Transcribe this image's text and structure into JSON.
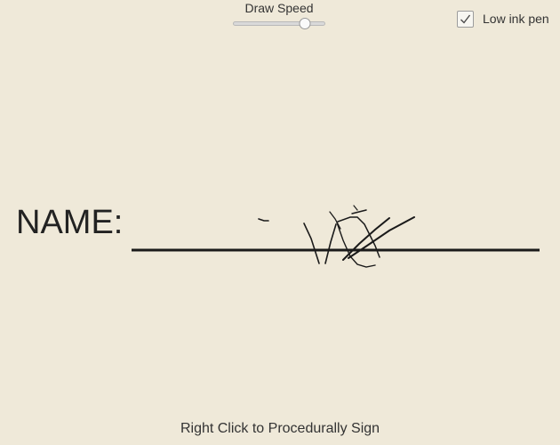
{
  "controls": {
    "draw_speed_label": "Draw Speed",
    "draw_speed_value": 0.78,
    "low_ink_label": "Low ink pen",
    "low_ink_checked": true
  },
  "form": {
    "name_label": "NAME:"
  },
  "footer": {
    "hint": "Right Click to Procedurally Sign"
  },
  "colors": {
    "background": "#efe9d9",
    "ink": "#1a1a1a"
  }
}
